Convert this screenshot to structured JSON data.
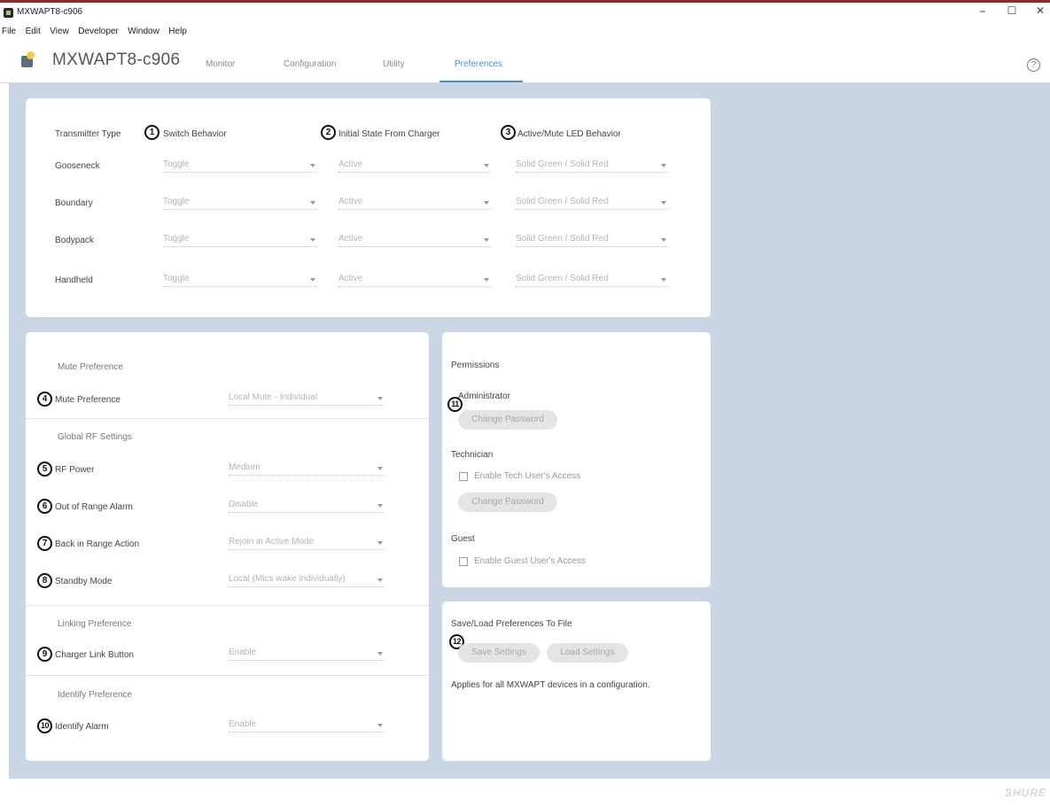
{
  "window": {
    "title": "MXWAPT8-c906",
    "minimize": "–",
    "maximize": "☐",
    "close": "✕"
  },
  "menu": [
    "File",
    "Edit",
    "View",
    "Developer",
    "Window",
    "Help"
  ],
  "header": {
    "device_name": "MXWAPT8-c906",
    "tabs": [
      "Monitor",
      "Configuration",
      "Utility",
      "Preferences"
    ],
    "active_tab": "Preferences",
    "help": "?"
  },
  "transmitter": {
    "col_type": "Transmitter Type",
    "col_switch": "Switch Behavior",
    "col_initial": "Initial State From Charger",
    "col_led": "Active/Mute LED Behavior",
    "badges": [
      "1",
      "2",
      "3"
    ],
    "rows": [
      {
        "type": "Gooseneck",
        "switch": "Toggle",
        "initial": "Active",
        "led": "Solid Green / Solid Red"
      },
      {
        "type": "Boundary",
        "switch": "Toggle",
        "initial": "Active",
        "led": "Solid Green / Solid Red"
      },
      {
        "type": "Bodypack",
        "switch": "Toggle",
        "initial": "Active",
        "led": "Solid Green / Solid Red"
      },
      {
        "type": "Handheld",
        "switch": "Toggle",
        "initial": "Active",
        "led": "Solid Green / Solid Red"
      }
    ]
  },
  "prefs": {
    "mute_section": "Mute Preference",
    "mute_label": "Mute Preference",
    "mute_value": "Local Mute - Individual",
    "rf_section": "Global RF Settings",
    "rf_power_label": "RF Power",
    "rf_power_value": "Medium",
    "oor_label": "Out of Range Alarm",
    "oor_value": "Disable",
    "bir_label": "Back in Range Action",
    "bir_value": "Rejoin in Active Mode",
    "standby_label": "Standby Mode",
    "standby_value": "Local (Mics wake individually)",
    "linking_section": "Linking Preference",
    "charger_label": "Charger Link Button",
    "charger_value": "Enable",
    "identify_section": "Identify Preference",
    "identify_label": "Identify Alarm",
    "identify_value": "Enable",
    "badges": [
      "4",
      "5",
      "6",
      "7",
      "8",
      "9",
      "10"
    ]
  },
  "permissions": {
    "title": "Permissions",
    "admin_label": "Administrator",
    "admin_change": "Change Password",
    "tech_label": "Technician",
    "tech_checkbox": "Enable Tech User's Access",
    "tech_change": "Change Password",
    "guest_label": "Guest",
    "guest_checkbox": "Enable Guest User's Access",
    "badge": "11"
  },
  "saveload": {
    "title": "Save/Load Preferences To File",
    "save": "Save Settings",
    "load": "Load Settings",
    "note": "Applies for all MXWAPT devices in a configuration.",
    "badge": "12"
  },
  "footer": {
    "brand": "SHURE"
  }
}
